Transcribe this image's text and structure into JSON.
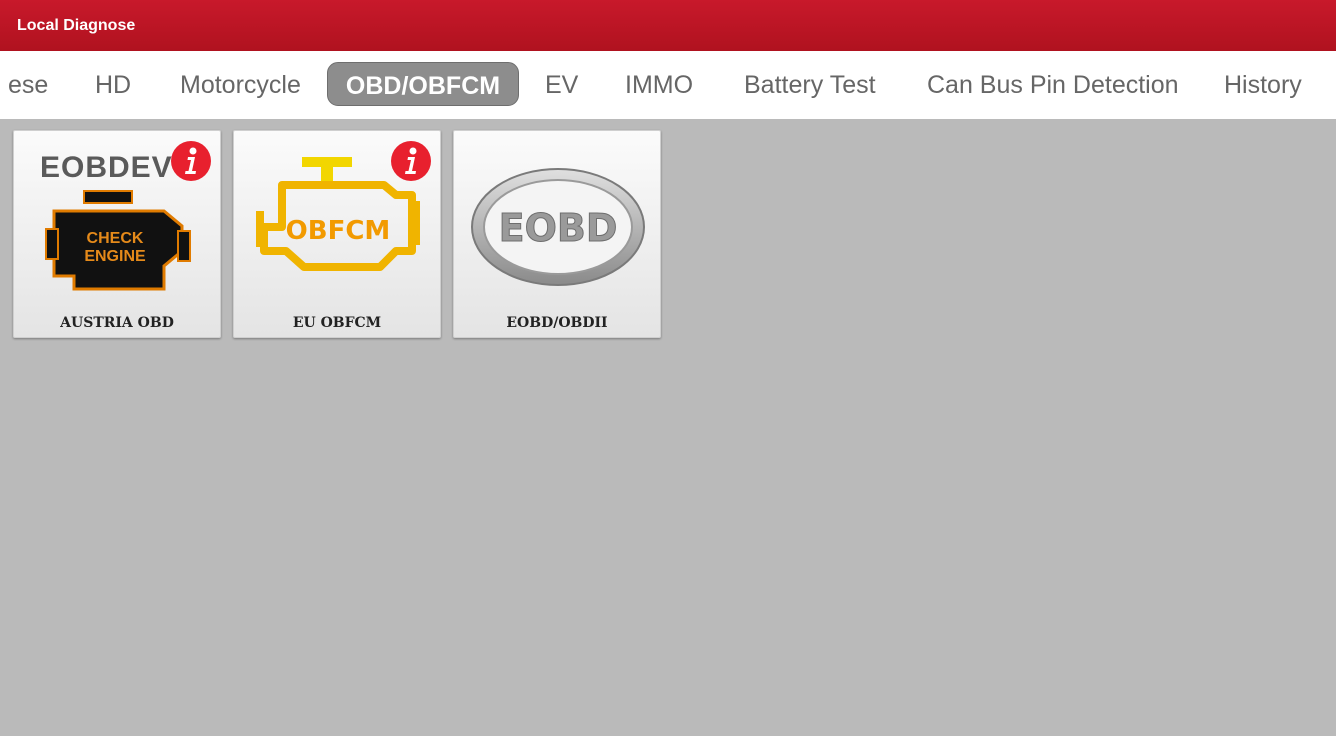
{
  "app": {
    "title": "Local Diagnose"
  },
  "tabs": [
    {
      "label": "ese"
    },
    {
      "label": "HD"
    },
    {
      "label": "Motorcycle"
    },
    {
      "label": "OBD/OBFCM",
      "active": true
    },
    {
      "label": "EV"
    },
    {
      "label": "IMMO"
    },
    {
      "label": "Battery Test"
    },
    {
      "label": "Can Bus Pin Detection"
    },
    {
      "label": "History"
    }
  ],
  "cards": [
    {
      "label": "AUSTRIA OBD",
      "logo_text": "EOBDEV",
      "engine_text_1": "CHECK",
      "engine_text_2": "ENGINE",
      "info_icon": "info-icon",
      "has_info": true
    },
    {
      "label": "EU OBFCM",
      "logo_text": "OBFCM",
      "info_icon": "info-icon",
      "has_info": true
    },
    {
      "label": "EOBD/OBDII",
      "logo_text": "EOBD",
      "has_info": false
    }
  ],
  "colors": {
    "header_red": "#c8192b",
    "active_tab_bg": "#8d8d8d",
    "content_bg": "#bababa",
    "badge_red": "#e8202e"
  }
}
